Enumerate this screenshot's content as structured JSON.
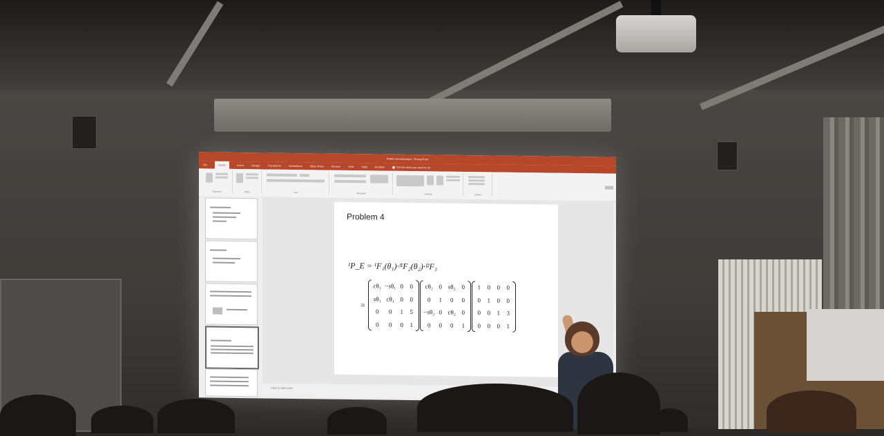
{
  "ppt": {
    "window_title": "PHBS mecatronique - PowerPoint",
    "tabs": [
      "File",
      "Home",
      "Insert",
      "Design",
      "Transitions",
      "Animations",
      "Slide Show",
      "Review",
      "View",
      "Help",
      "Acrobat"
    ],
    "tell_me": "Tell me what you want to do",
    "ribbon_groups": [
      "Clipboard",
      "Slides",
      "Font",
      "Paragraph",
      "Drawing",
      "Editing"
    ],
    "notes_placeholder": "Click to add notes"
  },
  "slide": {
    "title": "Problem 4",
    "equation": "ᴵP_E = ᴵF₁(θ₁)·ᶠ¹F₂(θ₂)·ᶠ²F₃",
    "equals": "=",
    "matrices": [
      [
        [
          "cθ₁",
          "−sθ₁",
          "0",
          "0"
        ],
        [
          "sθ₁",
          "cθ₁",
          "0",
          "0"
        ],
        [
          "0",
          "0",
          "1",
          "5"
        ],
        [
          "0",
          "0",
          "0",
          "1"
        ]
      ],
      [
        [
          "cθ₂",
          "0",
          "sθ₂",
          "0"
        ],
        [
          "0",
          "1",
          "0",
          "0"
        ],
        [
          "−sθ₂",
          "0",
          "cθ₂",
          "0"
        ],
        [
          "0",
          "0",
          "0",
          "1"
        ]
      ],
      [
        [
          "1",
          "0",
          "0",
          "0"
        ],
        [
          "0",
          "1",
          "0",
          "0"
        ],
        [
          "0",
          "0",
          "1",
          "3"
        ],
        [
          "0",
          "0",
          "0",
          "1"
        ]
      ]
    ]
  },
  "colors": {
    "powerpoint_accent": "#b7472a",
    "wall": "#46423f"
  }
}
